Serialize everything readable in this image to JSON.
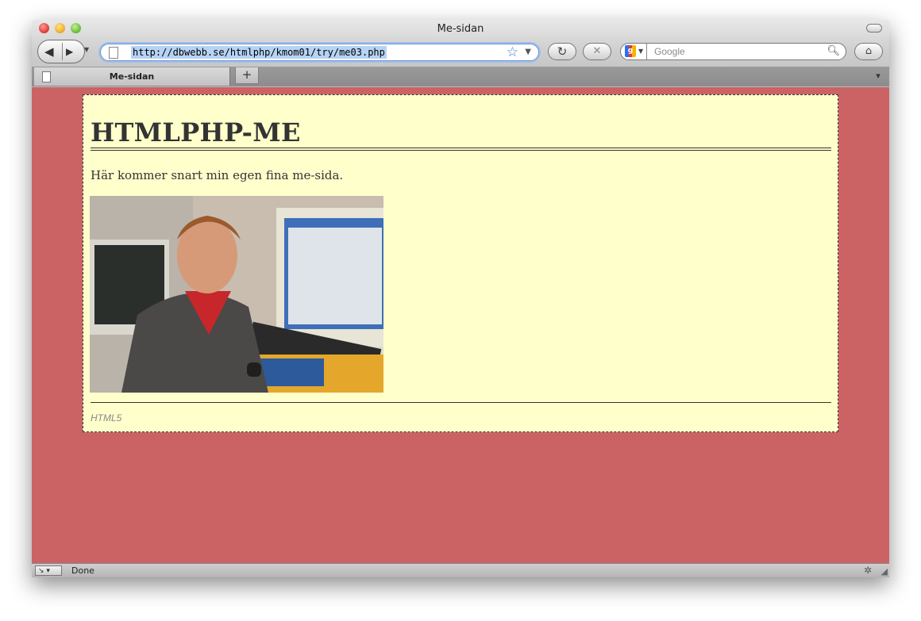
{
  "window": {
    "title": "Me-sidan"
  },
  "toolbar": {
    "url": "http://dbwebb.se/htmlphp/kmom01/try/me03.php",
    "search_placeholder": "Google"
  },
  "tabs": [
    {
      "label": "Me-sidan"
    }
  ],
  "page": {
    "heading": "HTMLPHP-ME",
    "intro": "Här kommer snart min egen fina me-sida.",
    "footer": "HTML5",
    "colors": {
      "background": "#cb6365",
      "box": "#ffffcc",
      "text": "#333333"
    }
  },
  "statusbar": {
    "text": "Done"
  }
}
